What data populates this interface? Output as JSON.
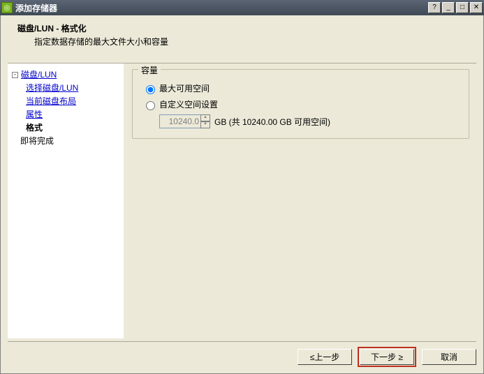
{
  "window": {
    "title": "添加存储器"
  },
  "header": {
    "title": "磁盘/LUN - 格式化",
    "desc": "指定数据存储的最大文件大小和容量"
  },
  "sidebar": {
    "root": "磁盘/LUN",
    "items": [
      {
        "label": "选择磁盘/LUN",
        "style": "link"
      },
      {
        "label": "当前磁盘布局",
        "style": "link"
      },
      {
        "label": "属性",
        "style": "link"
      },
      {
        "label": "格式",
        "style": "bold"
      },
      {
        "label": "即将完成",
        "style": "plain"
      }
    ]
  },
  "capacity": {
    "group_title": "容量",
    "radio_max": "最大可用空间",
    "radio_custom": "自定义空间设置",
    "selected": "max",
    "size_value": "10240.0",
    "size_suffix": "GB (共 10240.00 GB 可用空间)"
  },
  "footer": {
    "back": "≤上一步",
    "next": "下一步 ≥",
    "cancel": "取消"
  }
}
